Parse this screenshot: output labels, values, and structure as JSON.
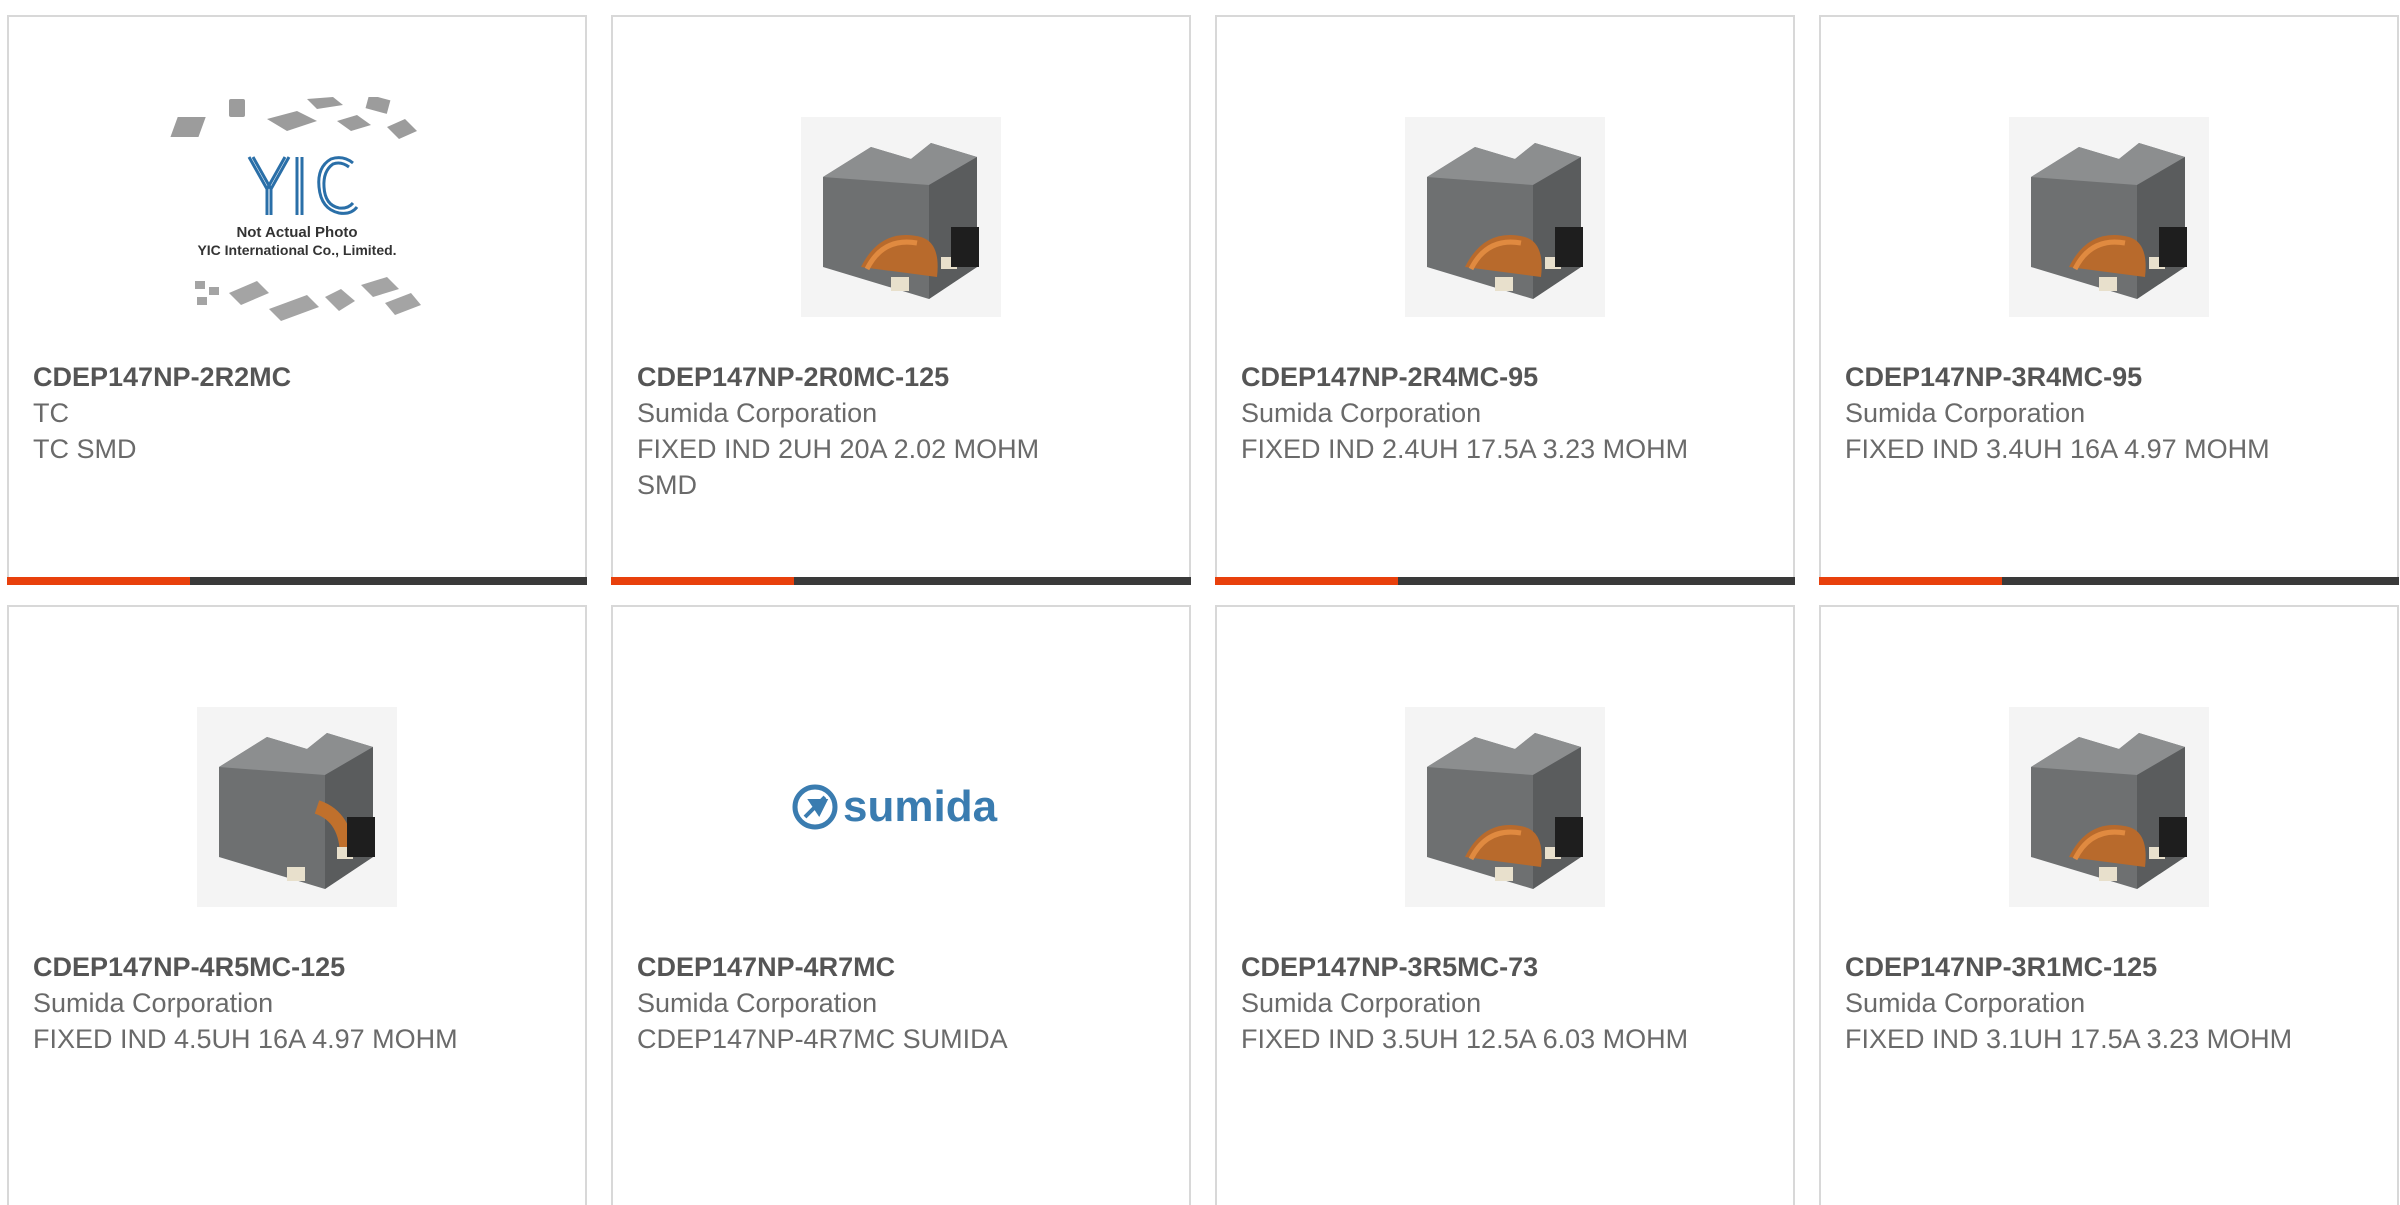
{
  "colors": {
    "accent": "#e8400c",
    "bar": "#3a3a3a",
    "border": "#d8d8d8",
    "text": "#6a6a6a"
  },
  "products": [
    {
      "part": "CDEP147NP-2R2MC",
      "maker": "TC",
      "desc": "TC SMD",
      "image": "placeholder",
      "placeholder": {
        "line1": "Not Actual Photo",
        "line2": "YIC International Co., Limited.",
        "logo": "YIC"
      }
    },
    {
      "part": "CDEP147NP-2R0MC-125",
      "maker": "Sumida Corporation",
      "desc": "FIXED IND 2UH 20A 2.02 MOHM SMD",
      "image": "inductor"
    },
    {
      "part": "CDEP147NP-2R4MC-95",
      "maker": "Sumida Corporation",
      "desc": "FIXED IND 2.4UH 17.5A 3.23 MOHM",
      "image": "inductor"
    },
    {
      "part": "CDEP147NP-3R4MC-95",
      "maker": "Sumida Corporation",
      "desc": "FIXED IND 3.4UH 16A 4.97 MOHM",
      "image": "inductor"
    },
    {
      "part": "CDEP147NP-4R5MC-125",
      "maker": "Sumida Corporation",
      "desc": "FIXED IND 4.5UH 16A 4.97 MOHM",
      "image": "inductor"
    },
    {
      "part": "CDEP147NP-4R7MC",
      "maker": "Sumida Corporation",
      "desc": "CDEP147NP-4R7MC SUMIDA",
      "image": "brand-logo",
      "logo_text": "sumida"
    },
    {
      "part": "CDEP147NP-3R5MC-73",
      "maker": "Sumida Corporation",
      "desc": "FIXED IND 3.5UH 12.5A 6.03 MOHM",
      "image": "inductor"
    },
    {
      "part": "CDEP147NP-3R1MC-125",
      "maker": "Sumida Corporation",
      "desc": "FIXED IND 3.1UH 17.5A 3.23 MOHM",
      "image": "inductor"
    }
  ]
}
